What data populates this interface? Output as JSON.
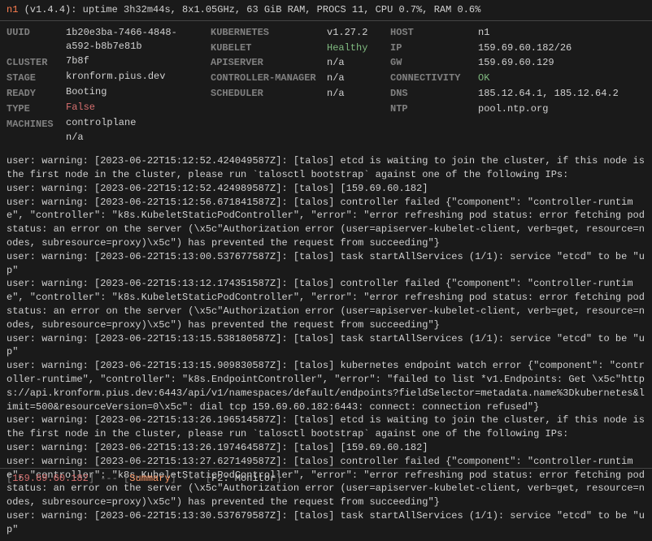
{
  "header": {
    "node": "n1",
    "info": "(v1.4.4): uptime 3h32m44s, 8x1.05GHz, 63 GiB RAM, PROCS 11, CPU 0.7%, RAM 0.6%"
  },
  "details": {
    "uuid_label": "UUID",
    "uuid": "1b20e3ba-7466-4848-a592-b8b7e81b7b8f",
    "cluster_label": "CLUSTER",
    "cluster": "kronform.pius.dev",
    "stage_label": "STAGE",
    "stage": "Booting",
    "ready_label": "READY",
    "ready": "False",
    "type_label": "TYPE",
    "type": "controlplane",
    "machines_label": "MACHINES",
    "machines": "n/a",
    "kubernetes_label": "KUBERNETES",
    "kubernetes": "v1.27.2",
    "kubelet_label": "KUBELET",
    "kubelet": "Healthy",
    "apiserver_label": "APISERVER",
    "apiserver": "n/a",
    "cm_label": "CONTROLLER-MANAGER",
    "cm": "n/a",
    "scheduler_label": "SCHEDULER",
    "scheduler": "n/a",
    "host_label": "HOST",
    "host": "n1",
    "ip_label": "IP",
    "ip": "159.69.60.182/26",
    "gw_label": "GW",
    "gw": "159.69.60.129",
    "conn_label": "CONNECTIVITY",
    "conn": "OK",
    "dns_label": "DNS",
    "dns": "185.12.64.1, 185.12.64.2",
    "ntp_label": "NTP",
    "ntp": "pool.ntp.org"
  },
  "logs": [
    "user: warning: [2023-06-22T15:12:52.424049587Z]: [talos] etcd is waiting to join the cluster, if this node is the first node in the cluster, please run `talosctl bootstrap` against one of the following IPs:",
    "user: warning: [2023-06-22T15:12:52.424989587Z]: [talos] [159.69.60.182]",
    "user: warning: [2023-06-22T15:12:56.671841587Z]: [talos] controller failed {\"component\": \"controller-runtime\", \"controller\": \"k8s.KubeletStaticPodController\", \"error\": \"error refreshing pod status: error fetching pod status: an error on the server (\\x5c\"Authorization error (user=apiserver-kubelet-client, verb=get, resource=nodes, subresource=proxy)\\x5c\") has prevented the request from succeeding\"}",
    "user: warning: [2023-06-22T15:13:00.537677587Z]: [talos] task startAllServices (1/1): service \"etcd\" to be \"up\"",
    "user: warning: [2023-06-22T15:13:12.174351587Z]: [talos] controller failed {\"component\": \"controller-runtime\", \"controller\": \"k8s.KubeletStaticPodController\", \"error\": \"error refreshing pod status: error fetching pod status: an error on the server (\\x5c\"Authorization error (user=apiserver-kubelet-client, verb=get, resource=nodes, subresource=proxy)\\x5c\") has prevented the request from succeeding\"}",
    "user: warning: [2023-06-22T15:13:15.538180587Z]: [talos] task startAllServices (1/1): service \"etcd\" to be \"up\"",
    "user: warning: [2023-06-22T15:13:15.909830587Z]: [talos] kubernetes endpoint watch error {\"component\": \"controller-runtime\", \"controller\": \"k8s.EndpointController\", \"error\": \"failed to list *v1.Endpoints: Get \\x5c\"https://api.kronform.pius.dev:6443/api/v1/namespaces/default/endpoints?fieldSelector=metadata.name%3Dkubernetes&limit=500&resourceVersion=0\\x5c\": dial tcp 159.69.60.182:6443: connect: connection refused\"}",
    "user: warning: [2023-06-22T15:13:26.196514587Z]: [talos] etcd is waiting to join the cluster, if this node is the first node in the cluster, please run `talosctl bootstrap` against one of the following IPs:",
    "user: warning: [2023-06-22T15:13:26.197464587Z]: [talos] [159.69.60.182]",
    "user: warning: [2023-06-22T15:13:27.627149587Z]: [talos] controller failed {\"component\": \"controller-runtime\", \"controller\": \"k8s.KubeletStaticPodController\", \"error\": \"error refreshing pod status: error fetching pod status: an error on the server (\\x5c\"Authorization error (user=apiserver-kubelet-client, verb=get, resource=nodes, subresource=proxy)\\x5c\") has prevented the request from succeeding\"}",
    "user: warning: [2023-06-22T15:13:30.537679587Z]: [talos] task startAllServices (1/1): service \"etcd\" to be \"up\""
  ],
  "footer": {
    "ip": "159.69.60.182",
    "summary": "Summary",
    "monitor": "F2: Monitor"
  }
}
